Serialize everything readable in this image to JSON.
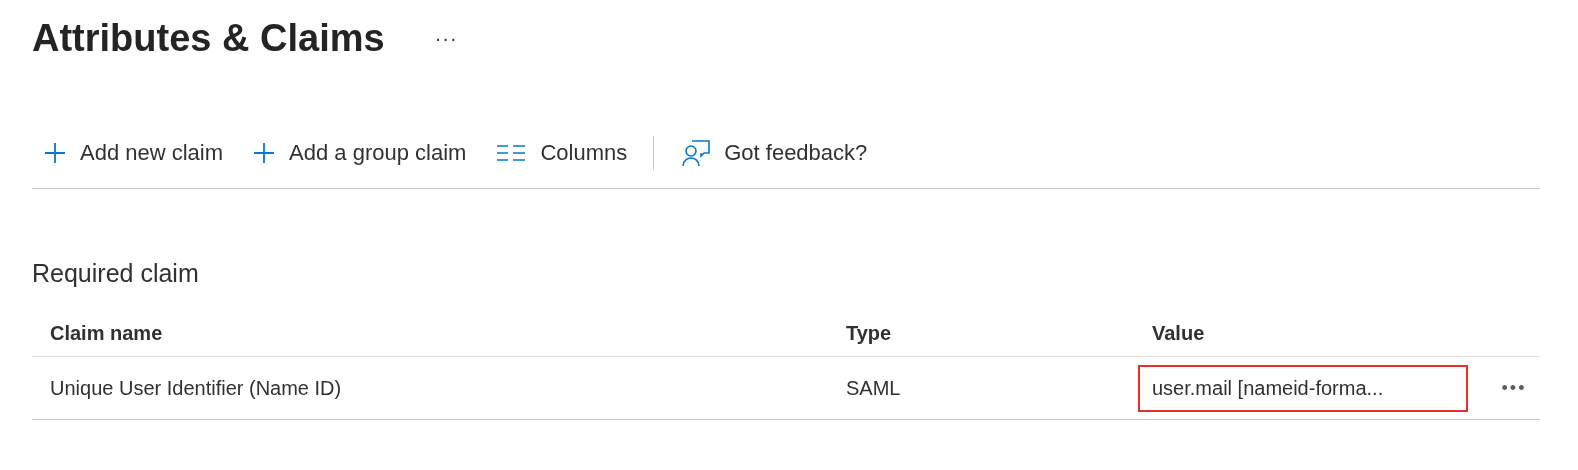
{
  "page": {
    "title": "Attributes & Claims",
    "more": "···"
  },
  "toolbar": [
    {
      "kind": "add",
      "label": "Add new claim"
    },
    {
      "kind": "add",
      "label": "Add a group claim"
    },
    {
      "kind": "columns",
      "label": "Columns"
    },
    {
      "kind": "feedback",
      "label": "Got feedback?"
    }
  ],
  "section": {
    "title": "Required claim"
  },
  "table": {
    "columns": [
      "Claim name",
      "Type",
      "Value"
    ],
    "rows": [
      {
        "cells": [
          {
            "text": "Unique User Identifier (Name ID)",
            "highlighted": false
          },
          {
            "text": "SAML",
            "highlighted": false
          },
          {
            "text": "user.mail [nameid-forma...",
            "highlighted": true
          }
        ],
        "more": "•••"
      }
    ]
  }
}
